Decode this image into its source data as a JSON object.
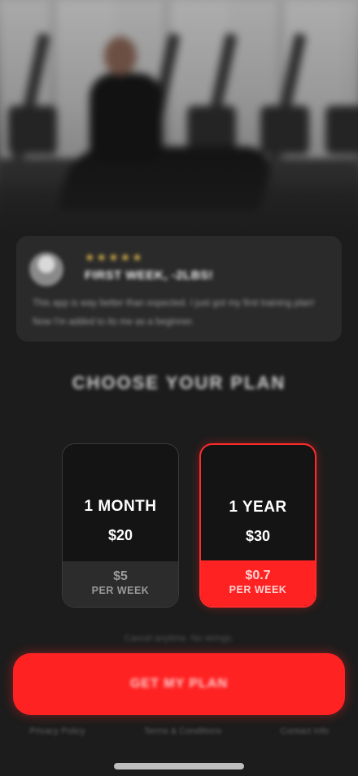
{
  "hero": {
    "image": "gym-workout-photo"
  },
  "testimonial": {
    "rating_stars": "★★★★★",
    "title": "FIRST WEEK, -2LBS!",
    "body": "This app is way better than expected. I just got my first training plan! Now I'm added to its me as a beginner."
  },
  "choose_heading": "CHOOSE YOUR PLAN",
  "plans": [
    {
      "name": "1 MONTH",
      "price": "$20",
      "per_week_price": "$5",
      "per_week_label": "PER WEEK",
      "selected": false
    },
    {
      "name": "1 YEAR",
      "price": "$30",
      "per_week_price": "$0.7",
      "per_week_label": "PER WEEK",
      "selected": true
    }
  ],
  "cancel_note": "Cancel anytime. No strings.",
  "cta_label": "GET MY PLAN",
  "footer_links": [
    "Privacy Policy",
    "Terms & Conditions",
    "Contact Info"
  ],
  "colors": {
    "accent": "#ff2222",
    "background": "#1c1c1c",
    "star": "#d8b24c"
  }
}
